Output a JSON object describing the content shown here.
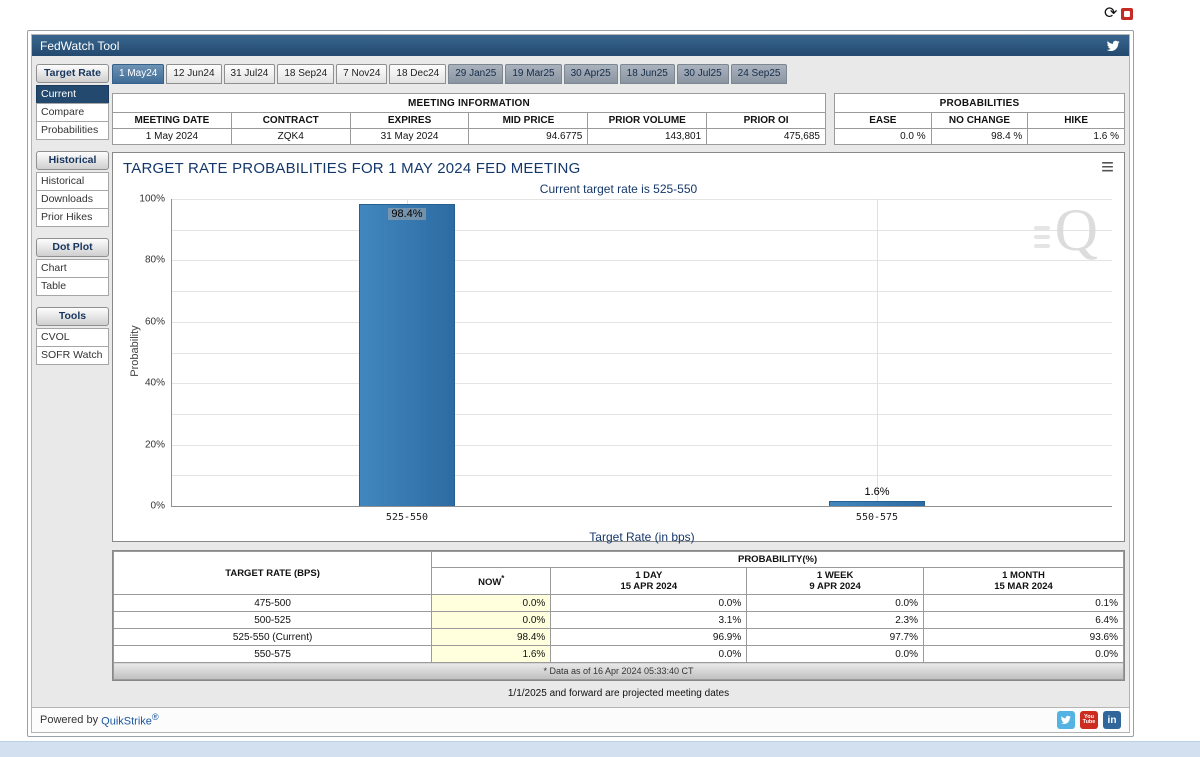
{
  "window": {
    "title": "FedWatch Tool"
  },
  "browser_icons": {
    "refresh": "⟳"
  },
  "tabs": [
    {
      "label": "1 May24"
    },
    {
      "label": "12 Jun24"
    },
    {
      "label": "31 Jul24"
    },
    {
      "label": "18 Sep24"
    },
    {
      "label": "7 Nov24"
    },
    {
      "label": "18 Dec24"
    },
    {
      "label": "29 Jan25"
    },
    {
      "label": "19 Mar25"
    },
    {
      "label": "30 Apr25"
    },
    {
      "label": "18 Jun25"
    },
    {
      "label": "30 Jul25"
    },
    {
      "label": "24 Sep25"
    }
  ],
  "sidebar": {
    "sections": [
      {
        "title": "Target Rate",
        "items": [
          {
            "label": "Current"
          },
          {
            "label": "Compare"
          },
          {
            "label": "Probabilities"
          }
        ]
      },
      {
        "title": "Historical",
        "items": [
          {
            "label": "Historical"
          },
          {
            "label": "Downloads"
          },
          {
            "label": "Prior Hikes"
          }
        ]
      },
      {
        "title": "Dot Plot",
        "items": [
          {
            "label": "Chart"
          },
          {
            "label": "Table"
          }
        ]
      },
      {
        "title": "Tools",
        "items": [
          {
            "label": "CVOL"
          },
          {
            "label": "SOFR Watch"
          }
        ]
      }
    ]
  },
  "meeting_info": {
    "title": "MEETING INFORMATION",
    "headers": [
      "MEETING DATE",
      "CONTRACT",
      "EXPIRES",
      "MID PRICE",
      "PRIOR VOLUME",
      "PRIOR OI"
    ],
    "values": [
      "1 May 2024",
      "ZQK4",
      "31 May 2024",
      "94.6775",
      "143,801",
      "475,685"
    ]
  },
  "probabilities_panel": {
    "title": "PROBABILITIES",
    "headers": [
      "EASE",
      "NO CHANGE",
      "HIKE"
    ],
    "values": [
      "0.0 %",
      "98.4 %",
      "1.6 %"
    ]
  },
  "chart": {
    "title": "TARGET RATE PROBABILITIES FOR 1 MAY 2024 FED MEETING",
    "subtitle": "Current target rate is 525-550",
    "menu_icon": "≡"
  },
  "chart_data": {
    "type": "bar",
    "title": "TARGET RATE PROBABILITIES FOR 1 MAY 2024 FED MEETING",
    "subtitle": "Current target rate is 525-550",
    "categories": [
      "525-550",
      "550-575"
    ],
    "values": [
      98.4,
      1.6
    ],
    "value_labels": [
      "98.4%",
      "1.6%"
    ],
    "xlabel": "Target Rate (in bps)",
    "ylabel": "Probability",
    "ylim": [
      0,
      100
    ],
    "yticks": [
      "0%",
      "20%",
      "40%",
      "60%",
      "80%",
      "100%"
    ],
    "grid": true,
    "legend": false,
    "bar_color": "#3276b1"
  },
  "prob_table": {
    "col1_header": "TARGET RATE (BPS)",
    "group_header": "PROBABILITY(%)",
    "sub_headers": [
      {
        "line1": "NOW",
        "sup": "*",
        "line2": ""
      },
      {
        "line1": "1 DAY",
        "sup": "",
        "line2": "15 APR 2024"
      },
      {
        "line1": "1 WEEK",
        "sup": "",
        "line2": "9 APR 2024"
      },
      {
        "line1": "1 MONTH",
        "sup": "",
        "line2": "15 MAR 2024"
      }
    ],
    "rows": [
      {
        "cells": [
          "475-500",
          "0.0%",
          "0.0%",
          "0.0%",
          "0.1%"
        ]
      },
      {
        "cells": [
          "500-525",
          "0.0%",
          "3.1%",
          "2.3%",
          "6.4%"
        ]
      },
      {
        "cells": [
          "525-550 (Current)",
          "98.4%",
          "96.9%",
          "97.7%",
          "93.6%"
        ]
      },
      {
        "cells": [
          "550-575",
          "1.6%",
          "0.0%",
          "0.0%",
          "0.0%"
        ]
      }
    ],
    "footnote": "* Data as of 16 Apr 2024 05:33:40 CT"
  },
  "notes": {
    "projected": "1/1/2025 and forward are projected meeting dates"
  },
  "footer": {
    "powered_by": "Powered by",
    "brand": "QuikStrike",
    "reg": "®",
    "social": {
      "youtube_line1": "You",
      "youtube_line2": "Tube",
      "linkedin": "in"
    }
  },
  "colors": {
    "titlebar": "#2b5580",
    "accent_navy": "#15386b",
    "bar": "#3276b1",
    "now_highlight": "#ffffdd"
  }
}
